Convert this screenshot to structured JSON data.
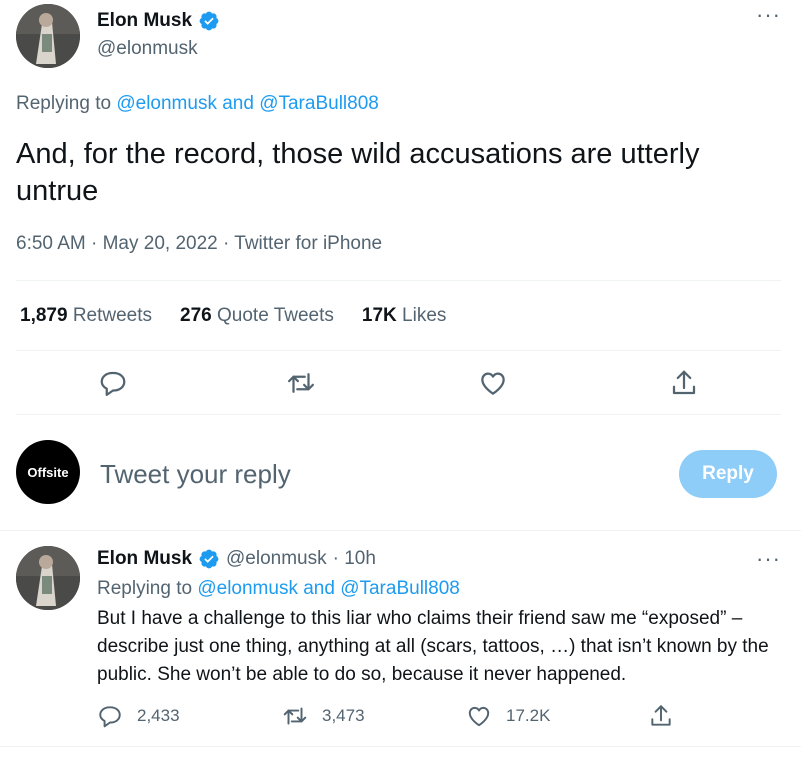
{
  "main_tweet": {
    "author_name": "Elon Musk",
    "author_handle": "@elonmusk",
    "replying_prefix": "Replying to ",
    "replying_to": "@elonmusk and @TaraBull808",
    "text": "And, for the record, those wild accusations are utterly untrue",
    "meta": "6:50 AM · May 20, 2022 · Twitter for iPhone",
    "stats": {
      "retweets_count": "1,879",
      "retweets_label": "Retweets",
      "quotes_count": "276",
      "quotes_label": "Quote Tweets",
      "likes_count": "17K",
      "likes_label": "Likes"
    }
  },
  "composer": {
    "avatar_text": "Offsite",
    "placeholder": "Tweet your reply",
    "button_label": "Reply"
  },
  "reply_tweet": {
    "author_name": "Elon Musk",
    "author_handle": "@elonmusk",
    "time": "· 10h",
    "replying_prefix": "Replying to ",
    "replying_to": "@elonmusk and @TaraBull808",
    "text": "But I have a challenge to this liar who claims their friend saw me “exposed” – describe just one thing, anything at all (scars, tattoos, …) that isn’t known by the public. She won’t be able to do so, because it never happened.",
    "replies": "2,433",
    "retweets": "3,473",
    "likes": "17.2K"
  },
  "colors": {
    "accent": "#1d9bf0",
    "muted": "#536471",
    "verified": "#1d9bf0",
    "reply_button": "#8ecdf8"
  },
  "icons": [
    "verified-badge-icon",
    "more-icon",
    "reply-icon",
    "retweet-icon",
    "like-icon",
    "share-icon"
  ]
}
